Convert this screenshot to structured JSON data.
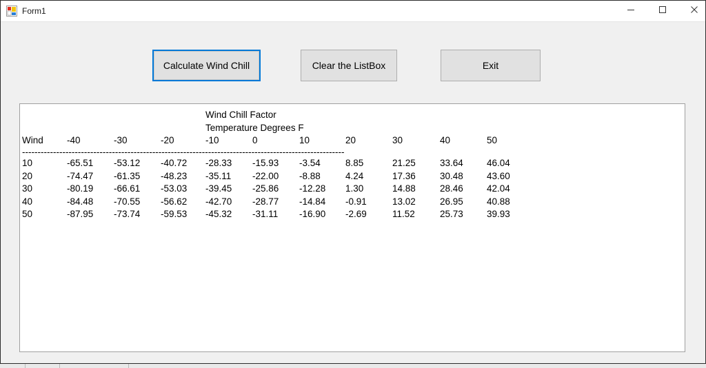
{
  "window": {
    "title": "Form1",
    "icon": "winforms-icon",
    "controls": {
      "minimize": "minimize-icon",
      "maximize": "maximize-icon",
      "close": "close-icon"
    }
  },
  "toolbar": {
    "calculate_label": "Calculate Wind Chill",
    "clear_label": "Clear the ListBox",
    "exit_label": "Exit"
  },
  "listbox": {
    "title_line_1": "Wind Chill Factor",
    "title_line_2": "Temperature Degrees F",
    "separator": "--------------------------------------------------------------------------------------------------------",
    "columns": [
      "Wind",
      "-40",
      "-30",
      "-20",
      "-10",
      "0",
      "10",
      "20",
      "30",
      "40",
      "50"
    ],
    "rows": [
      [
        "10",
        "-65.51",
        "-53.12",
        "-40.72",
        "-28.33",
        "-15.93",
        "-3.54",
        "8.85",
        "21.25",
        "33.64",
        "46.04"
      ],
      [
        "20",
        "-74.47",
        "-61.35",
        "-48.23",
        "-35.11",
        "-22.00",
        "-8.88",
        "4.24",
        "17.36",
        "30.48",
        "43.60"
      ],
      [
        "30",
        "-80.19",
        "-66.61",
        "-53.03",
        "-39.45",
        "-25.86",
        "-12.28",
        "1.30",
        "14.88",
        "28.46",
        "42.04"
      ],
      [
        "40",
        "-84.48",
        "-70.55",
        "-56.62",
        "-42.70",
        "-28.77",
        "-14.84",
        "-0.91",
        "13.02",
        "26.95",
        "40.88"
      ],
      [
        "50",
        "-87.95",
        "-73.74",
        "-59.53",
        "-45.32",
        "-31.11",
        "-16.90",
        "-2.69",
        "11.52",
        "25.73",
        "39.93"
      ]
    ]
  },
  "colors": {
    "focus_border": "#0078d7",
    "button_face": "#e1e1e1",
    "form_face": "#f0f0f0",
    "listbox_background": "#ffffff"
  }
}
